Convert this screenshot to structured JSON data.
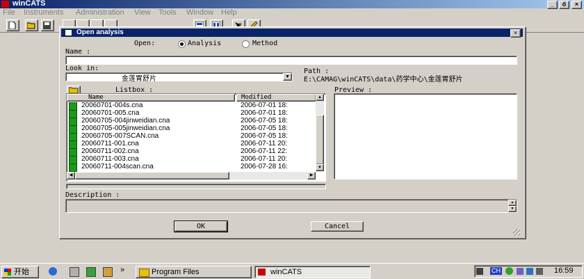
{
  "app": {
    "title": "winCATS"
  },
  "menu": [
    "File",
    "Instruments",
    "Administration",
    "View",
    "Tools",
    "Window",
    "Help"
  ],
  "caption_buttons": {
    "minimize": "_",
    "restore": "ő",
    "close": "×"
  },
  "dialog": {
    "title": "Open analysis",
    "close": "×",
    "open_label": "Open:",
    "radio_analysis": "Analysis",
    "radio_method": "Method",
    "name_label": "Name :",
    "name_value": "",
    "lookin_label": "Look in:",
    "lookin_value": "金莲胃舒片",
    "path_label": "Path :",
    "path_value": "E:\\CAMAG\\winCATS\\data\\药学中心\\金莲胃舒片",
    "listbox_label": "Listbox :",
    "preview_label": "Preview :",
    "columns": [
      "Name",
      "Modified"
    ],
    "files": [
      {
        "name": "20060701-004s.cna",
        "modified": "2006-07-01 18:"
      },
      {
        "name": "20060701-005.cna",
        "modified": "2006-07-01 18:"
      },
      {
        "name": "20060705-004jinweidian.cna",
        "modified": "2006-07-05 18:"
      },
      {
        "name": "20060705-005jinweidian.cna",
        "modified": "2006-07-05 18:"
      },
      {
        "name": "20060705-007SCAN.cna",
        "modified": "2006-07-05 18:"
      },
      {
        "name": "20060711-001.cna",
        "modified": "2006-07-11 20:"
      },
      {
        "name": "20060711-002.cna",
        "modified": "2006-07-11 22:"
      },
      {
        "name": "20060711-003.cna",
        "modified": "2006-07-11 20:"
      },
      {
        "name": "20060711-004scan.cna",
        "modified": "2006-07-28 16:"
      }
    ],
    "description_label": "Description :",
    "description_value": "",
    "ok_label": "OK",
    "cancel_label": "Cancel"
  },
  "taskbar": {
    "start_label": "开始",
    "chevron": "»",
    "task1": "Program Files",
    "task2": "winCATS",
    "lang": "CH",
    "clock": "16:59"
  }
}
